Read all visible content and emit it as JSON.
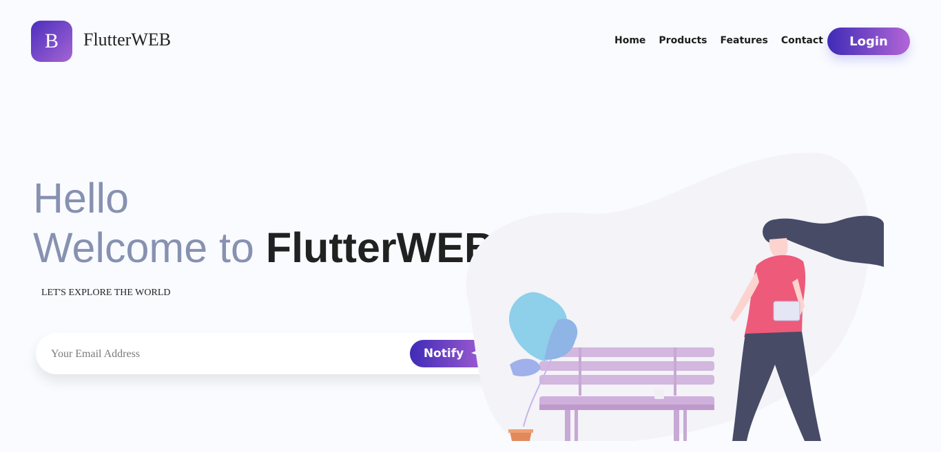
{
  "brand": {
    "logo_letter": "B",
    "name": "FlutterWEB"
  },
  "nav": {
    "items": [
      "Home",
      "Products",
      "Features",
      "Contact"
    ],
    "login_label": "Login"
  },
  "hero": {
    "line1": "Hello",
    "line2_prefix": "Welcome to ",
    "line2_highlight": "FlutterWEB",
    "tagline": "LET'S EXPLORE THE WORLD"
  },
  "subscribe": {
    "placeholder": "Your Email Address",
    "value": "",
    "button_label": "Notify",
    "button_icon": "paper-plane-icon"
  },
  "colors": {
    "accent_start": "#3f2bb7",
    "accent_end": "#b266d6",
    "heading_muted": "#8791b0"
  }
}
